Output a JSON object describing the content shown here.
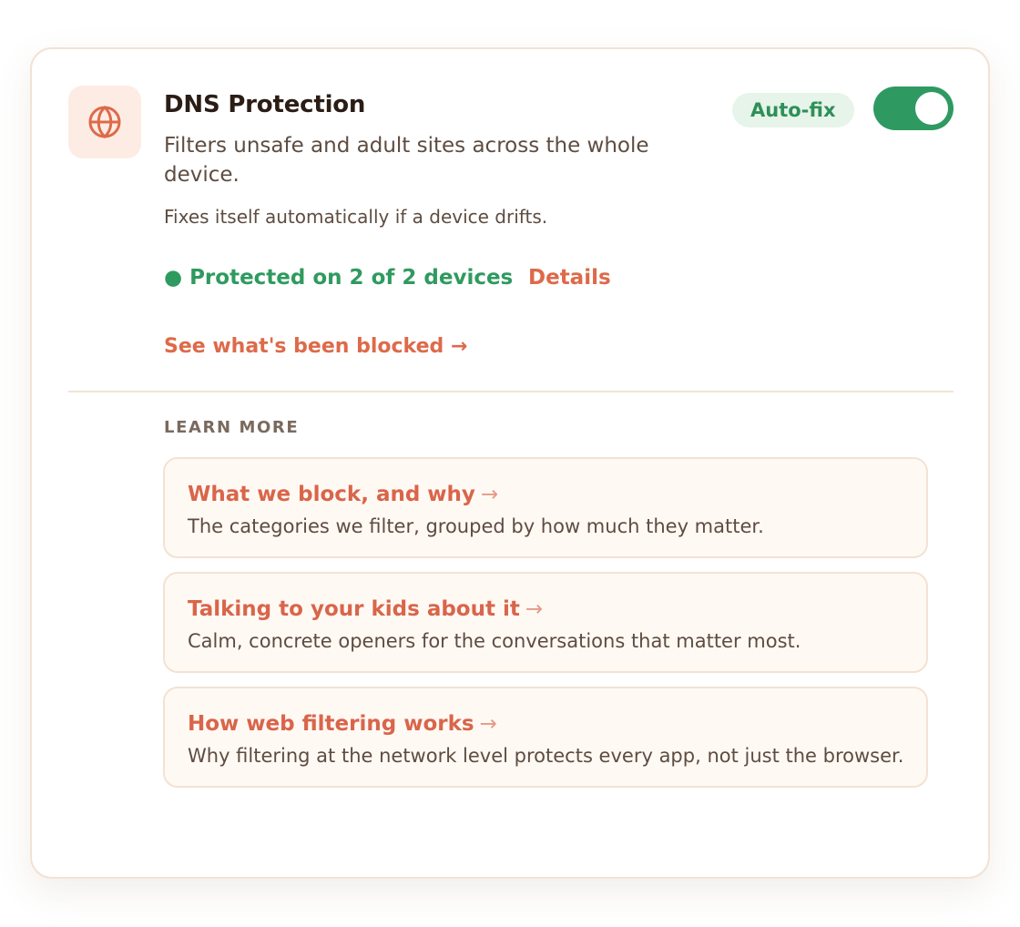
{
  "card": {
    "title": "DNS Protection",
    "description": "Filters unsafe and adult sites across the whole device.",
    "note": "Fixes itself automatically if a device drifts.",
    "badge": "Auto-fix",
    "toggle_on": true,
    "status": "● Protected on 2 of 2 devices",
    "details_label": "Details",
    "blocked_link": "See what's been blocked →"
  },
  "learn_more": {
    "heading": "LEARN MORE",
    "items": [
      {
        "title": "What we block, and why",
        "arrow": "→",
        "desc": "The categories we filter, grouped by how much they matter."
      },
      {
        "title": "Talking to your kids about it",
        "arrow": "→",
        "desc": "Calm, concrete openers for the conversations that matter most."
      },
      {
        "title": "How web filtering works",
        "arrow": "→",
        "desc": "Why filtering at the network level protects every app, not just the browser."
      }
    ]
  },
  "colors": {
    "accent": "#dd6a4a",
    "success": "#2f9a5f",
    "toggle": "#2e9a62",
    "icon_tile": "#fdece4"
  },
  "icons": {
    "service": "globe-icon"
  }
}
